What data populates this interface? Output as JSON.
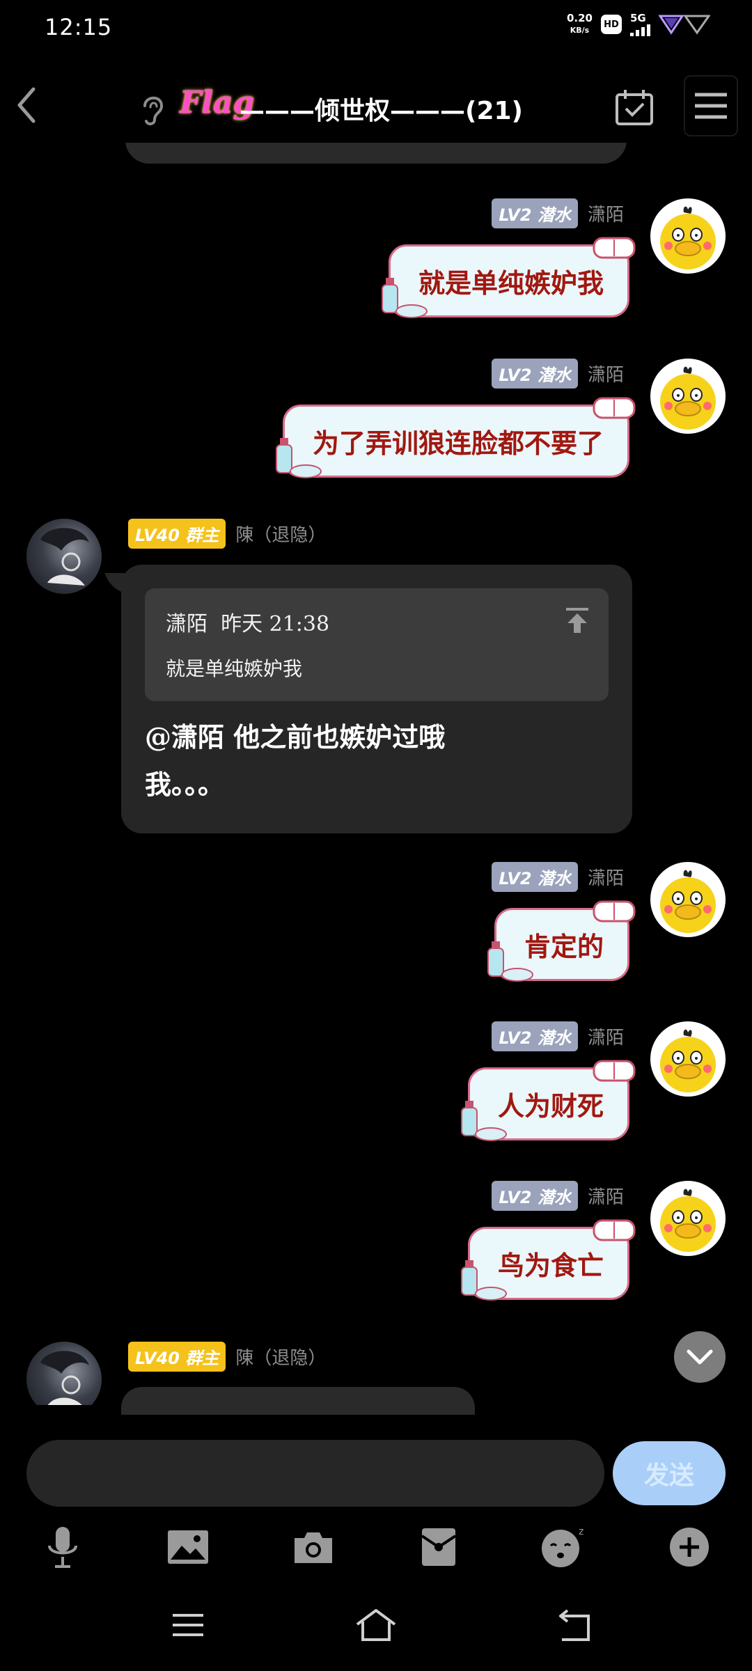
{
  "status": {
    "time": "12:15",
    "speed_value": "0.20",
    "speed_unit": "KB/s",
    "hd": "HD",
    "network": "5G"
  },
  "header": {
    "back_icon": "chevron-left-icon",
    "logo_text": "Flag",
    "title": "———倾世权———(21)",
    "calendar_icon": "calendar-check-icon",
    "menu_icon": "hamburger-icon"
  },
  "messages": [
    {
      "side": "right",
      "level": "LV2",
      "role": "潜水",
      "name": "潇陌",
      "text": "就是单纯嫉妒我"
    },
    {
      "side": "right",
      "level": "LV2",
      "role": "潜水",
      "name": "潇陌",
      "text": "为了弄训狼连脸都不要了"
    },
    {
      "side": "left",
      "level": "LV40",
      "role": "群主",
      "name": "陳（退隐）",
      "quote": {
        "sender": "潇陌",
        "time": "昨天 21:38",
        "text": "就是单纯嫉妒我"
      },
      "text": "@潇陌 他之前也嫉妒过哦我。。。"
    },
    {
      "side": "right",
      "level": "LV2",
      "role": "潜水",
      "name": "潇陌",
      "text": "肯定的"
    },
    {
      "side": "right",
      "level": "LV2",
      "role": "潜水",
      "name": "潇陌",
      "text": "人为财死"
    },
    {
      "side": "right",
      "level": "LV2",
      "role": "潜水",
      "name": "潇陌",
      "text": "鸟为食亡"
    },
    {
      "side": "left",
      "level": "LV40",
      "role": "群主",
      "name": "陳（退隐）"
    }
  ],
  "input": {
    "placeholder": "",
    "send_label": "发送"
  },
  "toolbar": [
    "mic-icon",
    "image-icon",
    "camera-icon",
    "red-packet-icon",
    "emoji-icon",
    "plus-icon"
  ],
  "navbar": [
    "menu-icon",
    "home-icon",
    "back-icon"
  ],
  "colors": {
    "background": "#000000",
    "bubble_right_bg": "#eaf7fb",
    "bubble_right_text": "#a11810",
    "bubble_left_bg": "#262626",
    "lv2_badge": "#9aa3bb",
    "lv40_badge": "#f5c21b",
    "send_button": "#a9cff8"
  }
}
